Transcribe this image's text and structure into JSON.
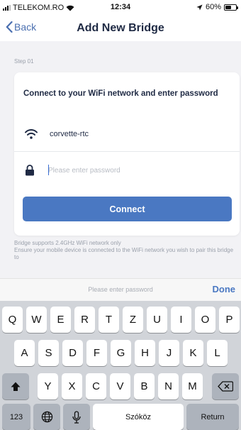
{
  "status_bar": {
    "carrier": "TELEKOM.RO",
    "time": "12:34",
    "battery": "60%",
    "battery_level": 0.6
  },
  "nav": {
    "back_label": "Back",
    "title": "Add New Bridge"
  },
  "step_label": "Step 01",
  "card": {
    "title": "Connect to your WiFi network and enter password",
    "ssid": "corvette-rtc",
    "password_placeholder": "Please enter password",
    "password_value": "",
    "connect_label": "Connect"
  },
  "help_text": "Bridge supports 2.4GHz WiFi network only\nEnsure your mobile device is connected to the WiFi network you wish to pair this bridge to",
  "accessory": {
    "hint": "Please enter password",
    "done_label": "Done"
  },
  "keyboard": {
    "row1": [
      "Q",
      "W",
      "E",
      "R",
      "T",
      "Z",
      "U",
      "I",
      "O",
      "P"
    ],
    "row2": [
      "A",
      "S",
      "D",
      "F",
      "G",
      "H",
      "J",
      "K",
      "L"
    ],
    "row3": [
      "Y",
      "X",
      "C",
      "V",
      "B",
      "N",
      "M"
    ],
    "numbers_label": "123",
    "space_label": "Szóköz",
    "return_label": "Return"
  },
  "colors": {
    "accent": "#4a78c2",
    "background": "#f2f2f5"
  }
}
